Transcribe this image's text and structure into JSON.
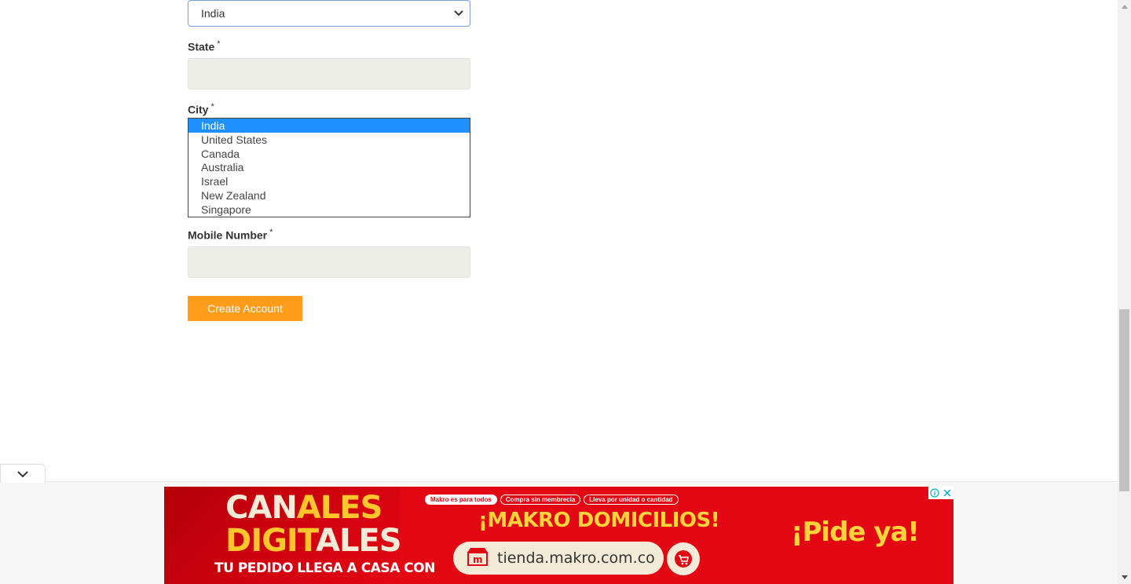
{
  "form": {
    "country_select": {
      "value": "India"
    },
    "state": {
      "label": "State",
      "required_mark": "*",
      "value": ""
    },
    "city": {
      "label": "City",
      "required_mark": "*",
      "options": [
        "India",
        "United States",
        "Canada",
        "Australia",
        "Israel",
        "New Zealand",
        "Singapore"
      ],
      "selected": "India"
    },
    "mobile": {
      "label": "Mobile Number",
      "required_mark": "*",
      "value": ""
    },
    "submit_label": "Create Account"
  },
  "ad": {
    "headline_1a": "CAN",
    "headline_1b": "ALES",
    "headline_2a": "DIGIT",
    "headline_2b": "ALES",
    "tagline": "TU PEDIDO LLEGA A CASA CON",
    "pills": [
      "Makro es para todos",
      "Compra sin membrecía",
      "Lleva por unidad o cantidad"
    ],
    "title": "¡MAKRO DOMICILIOS!",
    "url": "tienda.makro.com.co",
    "cta": "¡Pide ya!",
    "info_icon": "info-icon",
    "close_icon": "close-icon",
    "colors": {
      "banner_red": "#e30613",
      "accent_yellow": "#ffd43b",
      "cream": "#f3ead7"
    }
  },
  "colors": {
    "button_orange": "#ff9c1a",
    "selected_option": "#1e90ff",
    "input_bg": "#eeeee8"
  }
}
